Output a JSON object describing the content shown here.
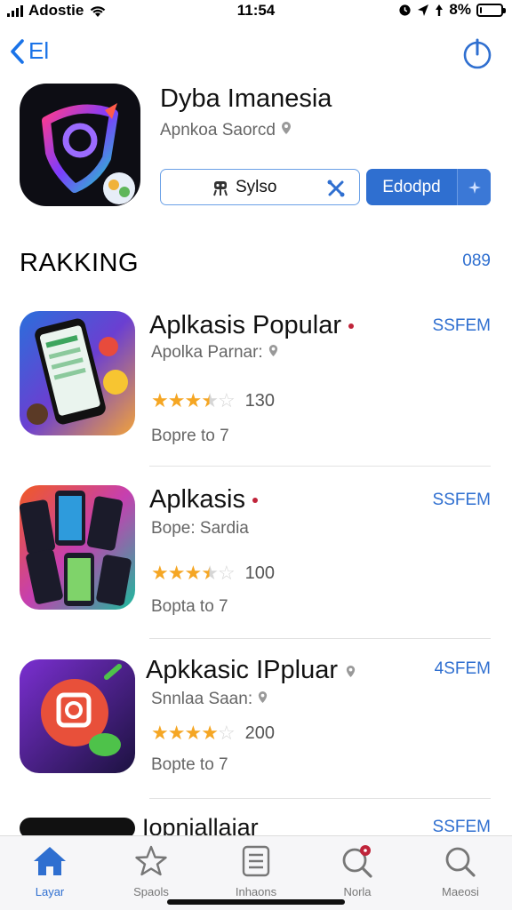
{
  "status_bar": {
    "carrier": "Adostie",
    "time": "11:54",
    "battery": "8%",
    "battery_level": 0.08
  },
  "nav": {
    "back_label": "El",
    "share_icon": "share-icon"
  },
  "app": {
    "title": "Dyba Imanesia",
    "subtitle": "Apnkoa Saorcd",
    "secondary_button": "Sylso",
    "primary_button": "Edodpd"
  },
  "section": {
    "title": "RAKKING",
    "link": "089"
  },
  "items": [
    {
      "name": "Aplkasis Popular",
      "get": "SSFEM",
      "sub": "Apolka Parnar:",
      "stars": 3.5,
      "count": "130",
      "size": "Bopre to 7",
      "colors": [
        "#2a6fdb",
        "#f2a33a",
        "#e84b3c"
      ]
    },
    {
      "name": "Aplkasis",
      "get": "SSFEM",
      "sub": "Bope: Sardia",
      "stars": 3.5,
      "count": "100",
      "size": "Bopta to 7",
      "colors": [
        "#f15a24",
        "#8e44ad",
        "#1abc9c"
      ]
    },
    {
      "name": "Apkkasic IPpluar",
      "get": "4SFEM",
      "sub": "Snnlaa Saan:",
      "stars": 4,
      "count": "200",
      "size": "Bopte to 7",
      "colors": [
        "#e74c3c",
        "#9b59b6",
        "#2ecc71"
      ]
    },
    {
      "name": "Iopniallaiar",
      "get": "SSFEM"
    }
  ],
  "tabbar": {
    "tabs": [
      {
        "label": "Layar",
        "icon": "home-icon"
      },
      {
        "label": "Spaols",
        "icon": "star-icon"
      },
      {
        "label": "Inhaons",
        "icon": "list-icon"
      },
      {
        "label": "Norla",
        "icon": "search-badge-icon"
      },
      {
        "label": "Maeosi",
        "icon": "search-icon"
      }
    ]
  },
  "colors": {
    "accent": "#2f6fd0",
    "star": "#f5a623",
    "badge": "#c0243a"
  }
}
